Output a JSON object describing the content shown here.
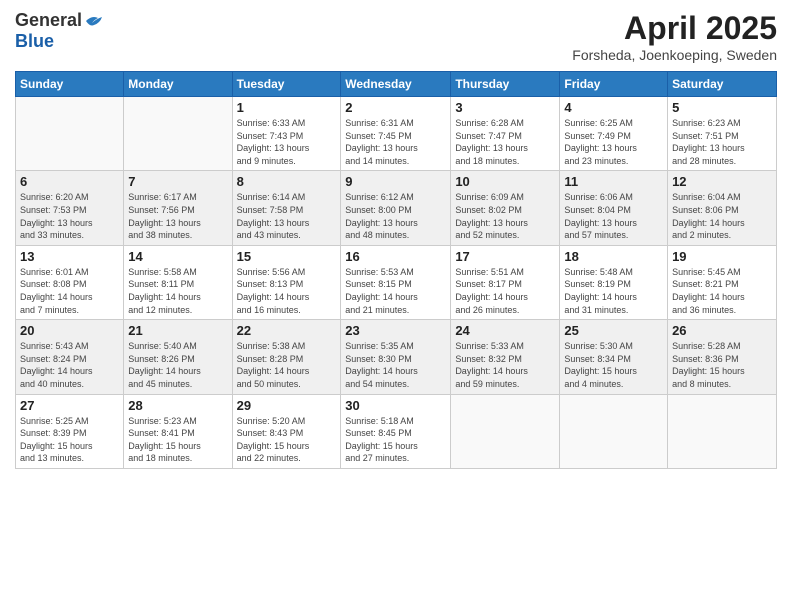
{
  "header": {
    "logo_general": "General",
    "logo_blue": "Blue",
    "month_title": "April 2025",
    "location": "Forsheda, Joenkoeping, Sweden"
  },
  "days_of_week": [
    "Sunday",
    "Monday",
    "Tuesday",
    "Wednesday",
    "Thursday",
    "Friday",
    "Saturday"
  ],
  "weeks": [
    [
      {
        "day": "",
        "info": ""
      },
      {
        "day": "",
        "info": ""
      },
      {
        "day": "1",
        "info": "Sunrise: 6:33 AM\nSunset: 7:43 PM\nDaylight: 13 hours\nand 9 minutes."
      },
      {
        "day": "2",
        "info": "Sunrise: 6:31 AM\nSunset: 7:45 PM\nDaylight: 13 hours\nand 14 minutes."
      },
      {
        "day": "3",
        "info": "Sunrise: 6:28 AM\nSunset: 7:47 PM\nDaylight: 13 hours\nand 18 minutes."
      },
      {
        "day": "4",
        "info": "Sunrise: 6:25 AM\nSunset: 7:49 PM\nDaylight: 13 hours\nand 23 minutes."
      },
      {
        "day": "5",
        "info": "Sunrise: 6:23 AM\nSunset: 7:51 PM\nDaylight: 13 hours\nand 28 minutes."
      }
    ],
    [
      {
        "day": "6",
        "info": "Sunrise: 6:20 AM\nSunset: 7:53 PM\nDaylight: 13 hours\nand 33 minutes."
      },
      {
        "day": "7",
        "info": "Sunrise: 6:17 AM\nSunset: 7:56 PM\nDaylight: 13 hours\nand 38 minutes."
      },
      {
        "day": "8",
        "info": "Sunrise: 6:14 AM\nSunset: 7:58 PM\nDaylight: 13 hours\nand 43 minutes."
      },
      {
        "day": "9",
        "info": "Sunrise: 6:12 AM\nSunset: 8:00 PM\nDaylight: 13 hours\nand 48 minutes."
      },
      {
        "day": "10",
        "info": "Sunrise: 6:09 AM\nSunset: 8:02 PM\nDaylight: 13 hours\nand 52 minutes."
      },
      {
        "day": "11",
        "info": "Sunrise: 6:06 AM\nSunset: 8:04 PM\nDaylight: 13 hours\nand 57 minutes."
      },
      {
        "day": "12",
        "info": "Sunrise: 6:04 AM\nSunset: 8:06 PM\nDaylight: 14 hours\nand 2 minutes."
      }
    ],
    [
      {
        "day": "13",
        "info": "Sunrise: 6:01 AM\nSunset: 8:08 PM\nDaylight: 14 hours\nand 7 minutes."
      },
      {
        "day": "14",
        "info": "Sunrise: 5:58 AM\nSunset: 8:11 PM\nDaylight: 14 hours\nand 12 minutes."
      },
      {
        "day": "15",
        "info": "Sunrise: 5:56 AM\nSunset: 8:13 PM\nDaylight: 14 hours\nand 16 minutes."
      },
      {
        "day": "16",
        "info": "Sunrise: 5:53 AM\nSunset: 8:15 PM\nDaylight: 14 hours\nand 21 minutes."
      },
      {
        "day": "17",
        "info": "Sunrise: 5:51 AM\nSunset: 8:17 PM\nDaylight: 14 hours\nand 26 minutes."
      },
      {
        "day": "18",
        "info": "Sunrise: 5:48 AM\nSunset: 8:19 PM\nDaylight: 14 hours\nand 31 minutes."
      },
      {
        "day": "19",
        "info": "Sunrise: 5:45 AM\nSunset: 8:21 PM\nDaylight: 14 hours\nand 36 minutes."
      }
    ],
    [
      {
        "day": "20",
        "info": "Sunrise: 5:43 AM\nSunset: 8:24 PM\nDaylight: 14 hours\nand 40 minutes."
      },
      {
        "day": "21",
        "info": "Sunrise: 5:40 AM\nSunset: 8:26 PM\nDaylight: 14 hours\nand 45 minutes."
      },
      {
        "day": "22",
        "info": "Sunrise: 5:38 AM\nSunset: 8:28 PM\nDaylight: 14 hours\nand 50 minutes."
      },
      {
        "day": "23",
        "info": "Sunrise: 5:35 AM\nSunset: 8:30 PM\nDaylight: 14 hours\nand 54 minutes."
      },
      {
        "day": "24",
        "info": "Sunrise: 5:33 AM\nSunset: 8:32 PM\nDaylight: 14 hours\nand 59 minutes."
      },
      {
        "day": "25",
        "info": "Sunrise: 5:30 AM\nSunset: 8:34 PM\nDaylight: 15 hours\nand 4 minutes."
      },
      {
        "day": "26",
        "info": "Sunrise: 5:28 AM\nSunset: 8:36 PM\nDaylight: 15 hours\nand 8 minutes."
      }
    ],
    [
      {
        "day": "27",
        "info": "Sunrise: 5:25 AM\nSunset: 8:39 PM\nDaylight: 15 hours\nand 13 minutes."
      },
      {
        "day": "28",
        "info": "Sunrise: 5:23 AM\nSunset: 8:41 PM\nDaylight: 15 hours\nand 18 minutes."
      },
      {
        "day": "29",
        "info": "Sunrise: 5:20 AM\nSunset: 8:43 PM\nDaylight: 15 hours\nand 22 minutes."
      },
      {
        "day": "30",
        "info": "Sunrise: 5:18 AM\nSunset: 8:45 PM\nDaylight: 15 hours\nand 27 minutes."
      },
      {
        "day": "",
        "info": ""
      },
      {
        "day": "",
        "info": ""
      },
      {
        "day": "",
        "info": ""
      }
    ]
  ]
}
